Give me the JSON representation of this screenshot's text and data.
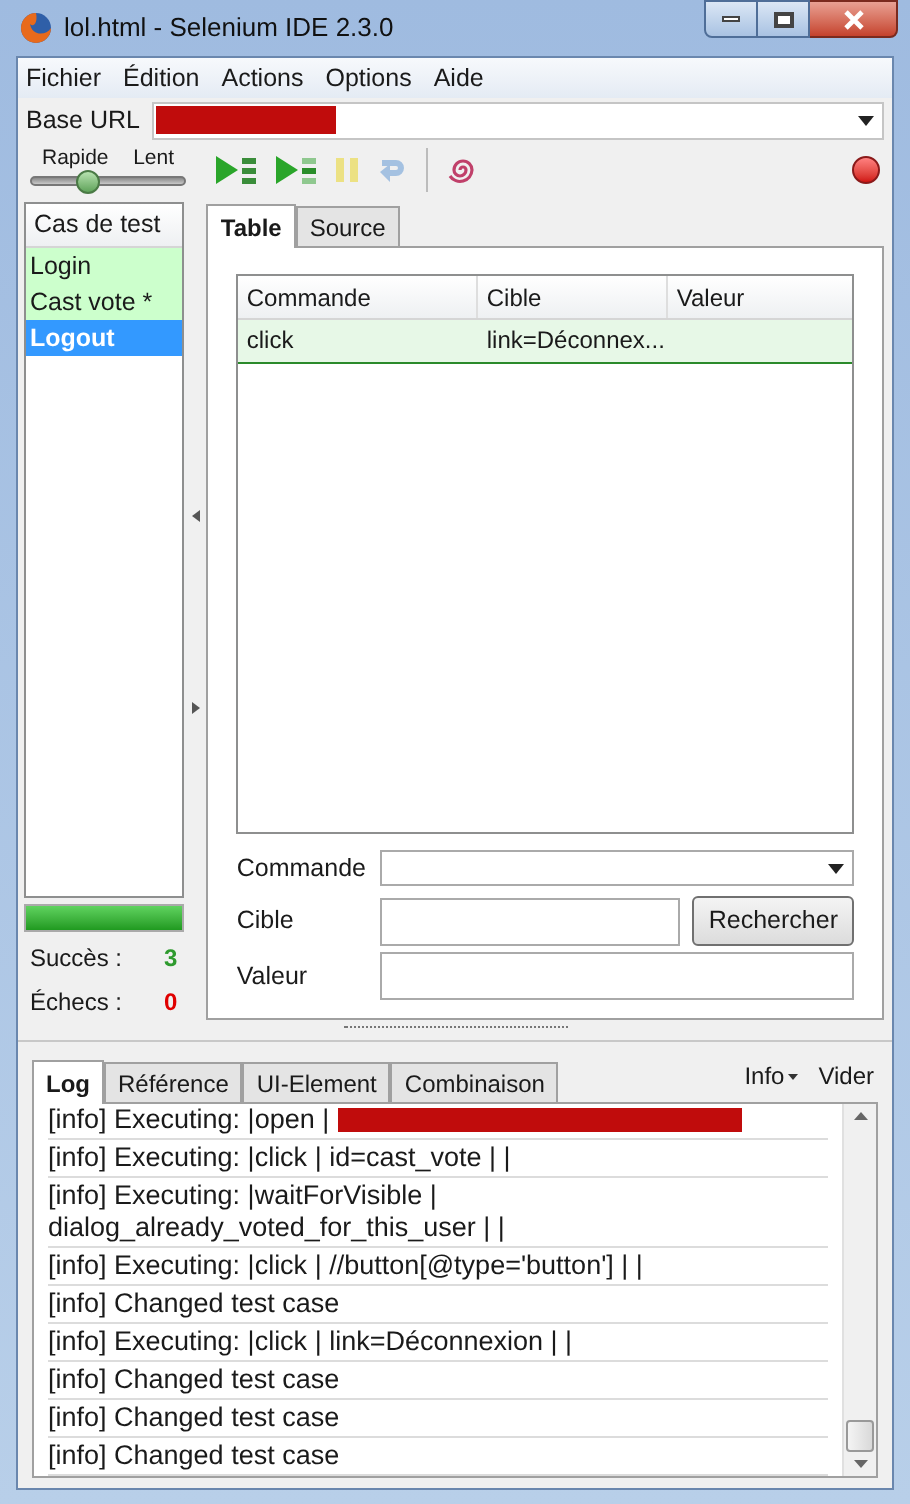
{
  "window": {
    "title": "lol.html - Selenium IDE 2.3.0"
  },
  "menu": [
    "Fichier",
    "Édition",
    "Actions",
    "Options",
    "Aide"
  ],
  "base_url": {
    "label": "Base URL",
    "redacted": true
  },
  "speed": {
    "fast_label": "Rapide",
    "slow_label": "Lent",
    "level": 0.37
  },
  "toolbar": [
    {
      "kind": "play-all",
      "disabled": false
    },
    {
      "kind": "play-one",
      "disabled": false
    },
    {
      "kind": "pause",
      "disabled": true
    },
    {
      "kind": "step",
      "disabled": true
    },
    {
      "kind": "rollup",
      "disabled": false
    }
  ],
  "record": {
    "on": false
  },
  "test_cases": {
    "header": "Cas de test",
    "items": [
      {
        "name": "Login",
        "selected": false,
        "passed": true
      },
      {
        "name": "Cast vote *",
        "selected": false,
        "passed": true
      },
      {
        "name": "Logout",
        "selected": true
      }
    ]
  },
  "progress": {
    "level": 1
  },
  "results": [
    {
      "label": "Succès :",
      "count": "3",
      "kind": "success"
    },
    {
      "label": "Échecs :",
      "count": "0",
      "kind": "failure"
    }
  ],
  "editor_tabs": [
    {
      "label": "Table",
      "selected": true
    },
    {
      "label": "Source",
      "selected": false
    }
  ],
  "table": {
    "columns": [
      "Commande",
      "Cible",
      "Valeur"
    ],
    "rows": [
      {
        "cells": [
          "click",
          "link=Déconnex...",
          ""
        ],
        "passed": true
      }
    ]
  },
  "fields": [
    {
      "label": "Commande",
      "kind": "select"
    },
    {
      "label": "Cible",
      "kind": "text",
      "button": "Rechercher"
    },
    {
      "label": "Valeur",
      "kind": "text"
    }
  ],
  "log_tabs": [
    {
      "label": "Log",
      "selected": true
    },
    {
      "label": "Référence",
      "selected": false
    },
    {
      "label": "UI-Element",
      "selected": false
    },
    {
      "label": "Combinaison",
      "selected": false
    }
  ],
  "log_actions": {
    "filter": "Info",
    "clear": "Vider"
  },
  "log": [
    {
      "text": "[info] Executing: |open |",
      "redacted": true
    },
    {
      "text": "[info] Executing: |click | id=cast_vote | |"
    },
    {
      "text": "[info] Executing: |waitForVisible | dialog_already_voted_for_this_user | |"
    },
    {
      "text": "[info] Executing: |click | //button[@type='button'] | |"
    },
    {
      "text": "[info] Changed test case"
    },
    {
      "text": "[info] Executing: |click | link=Déconnexion | |"
    },
    {
      "text": "[info] Changed test case"
    },
    {
      "text": "[info] Changed test case"
    },
    {
      "text": "[info] Changed test case"
    }
  ]
}
